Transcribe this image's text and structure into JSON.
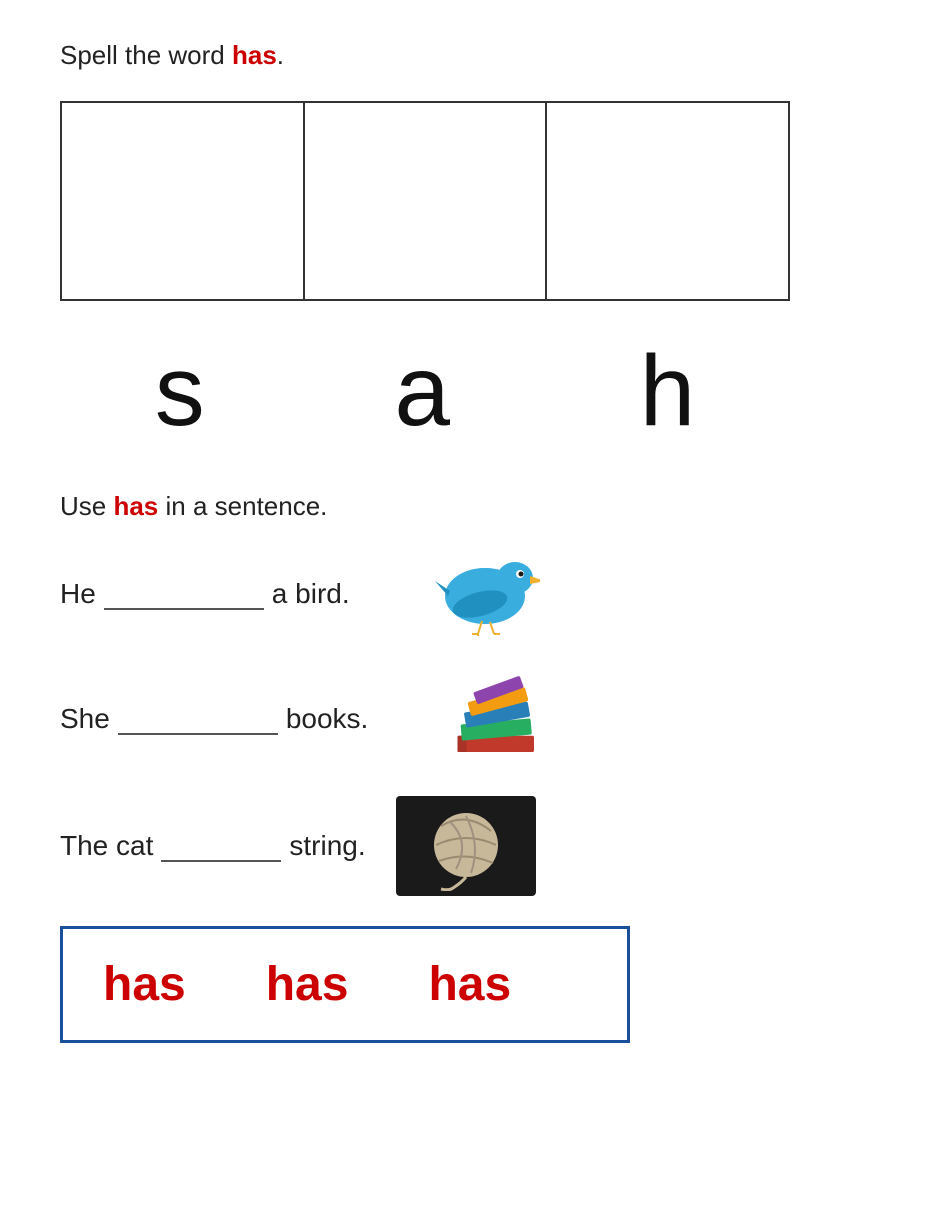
{
  "instruction": {
    "prefix": "Spell the word ",
    "highlight": "has",
    "suffix": "."
  },
  "letters": [
    "s",
    "a",
    "h"
  ],
  "sentence_section": {
    "label_prefix": "Use ",
    "label_highlight": "has",
    "label_suffix": " in a sentence."
  },
  "sentences": [
    {
      "before": "He",
      "after": "a bird.",
      "image": "bird"
    },
    {
      "before": "She",
      "after": "books.",
      "image": "books"
    },
    {
      "before": "The cat",
      "after": "string.",
      "image": "yarn"
    }
  ],
  "word_box": {
    "words": [
      "has",
      "has",
      "has"
    ]
  }
}
